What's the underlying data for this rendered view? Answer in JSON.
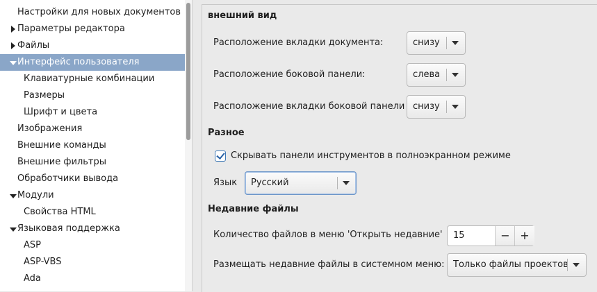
{
  "tree": {
    "items": [
      {
        "label": "Настройки для новых документов"
      },
      {
        "label": "Параметры редактора"
      },
      {
        "label": "Файлы"
      },
      {
        "label": "Интерфейс пользователя"
      },
      {
        "label": "Клавиатурные комбинации"
      },
      {
        "label": "Размеры"
      },
      {
        "label": "Шрифт и цвета"
      },
      {
        "label": "Изображения"
      },
      {
        "label": "Внешние команды"
      },
      {
        "label": "Внешние фильтры"
      },
      {
        "label": "Обработчики вывода"
      },
      {
        "label": "Модули"
      },
      {
        "label": "Свойства HTML"
      },
      {
        "label": "Языковая поддержка"
      },
      {
        "label": "ASP"
      },
      {
        "label": "ASP-VBS"
      },
      {
        "label": "Ada"
      }
    ]
  },
  "appearance": {
    "heading": "внешний вид",
    "tab_position_label": "Расположение вкладки документа:",
    "tab_position_value": "снизу",
    "sidebar_position_label": "Расположение боковой панели:",
    "sidebar_position_value": "слева",
    "sidebar_tab_position_label": "Расположение вкладки боковой панели",
    "sidebar_tab_position_value": "снизу"
  },
  "misc": {
    "heading": "Разное",
    "hide_toolbars_label": "Скрывать панели инструментов в полноэкранном режиме",
    "hide_toolbars_checked": true,
    "language_label": "Язык",
    "language_value": "Русский"
  },
  "recent": {
    "heading": "Недавние файлы",
    "count_label": "Количество файлов в меню 'Открыть недавние'",
    "count_value": "15",
    "minus": "−",
    "plus": "+",
    "system_menu_label": "Размещать недавние файлы в системном меню:",
    "system_menu_value": "Только файлы проектов"
  },
  "colors": {
    "selection": "#8aa6c8",
    "focus": "#6d96c9"
  }
}
